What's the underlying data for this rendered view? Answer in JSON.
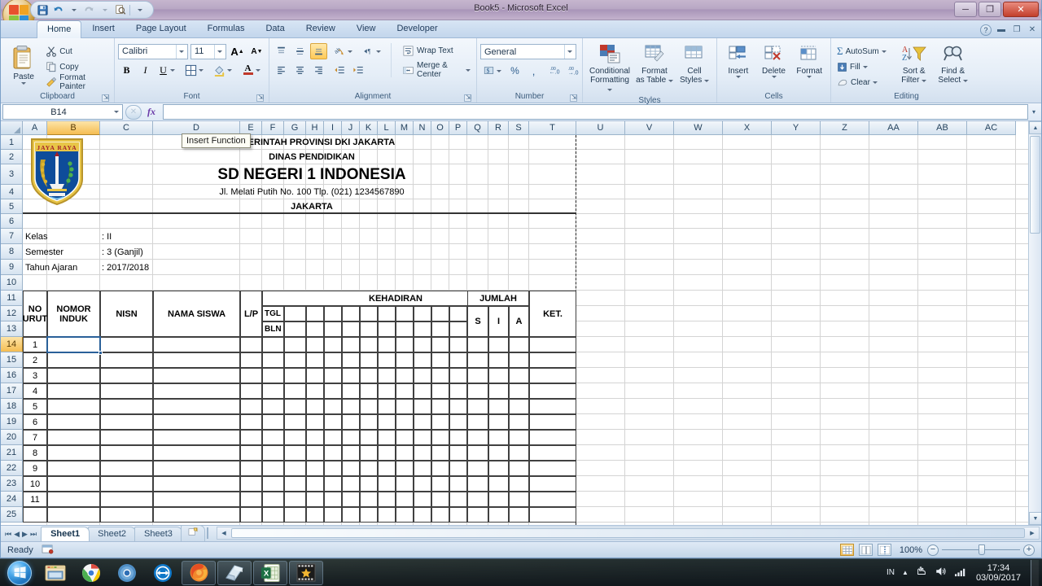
{
  "window": {
    "title": "Book5 - Microsoft Excel",
    "minimize": "─",
    "restore": "❐",
    "close": "✕"
  },
  "quick_access": {
    "save": "save-icon",
    "undo": "undo-icon",
    "redo": "redo-icon",
    "print_preview": "print-preview-icon",
    "customize": "customize-qat-icon"
  },
  "ribbon": {
    "tabs": [
      {
        "label": "Home",
        "active": true
      },
      {
        "label": "Insert",
        "active": false
      },
      {
        "label": "Page Layout",
        "active": false
      },
      {
        "label": "Formulas",
        "active": false
      },
      {
        "label": "Data",
        "active": false
      },
      {
        "label": "Review",
        "active": false
      },
      {
        "label": "View",
        "active": false
      },
      {
        "label": "Developer",
        "active": false
      }
    ],
    "help": "?",
    "minimize_ribbon": "▬",
    "restore_window": "❐",
    "close_window": "✕",
    "groups": {
      "clipboard": {
        "label": "Clipboard",
        "paste": "Paste",
        "cut": "Cut",
        "copy": "Copy",
        "format_painter": "Format Painter"
      },
      "font": {
        "label": "Font",
        "font_name": "Calibri",
        "font_size": "11",
        "grow_font": "A",
        "shrink_font": "A",
        "bold": "B",
        "italic": "I",
        "underline": "U",
        "borders": "borders-icon",
        "fill_color": "fill-color-icon",
        "font_color": "A"
      },
      "alignment": {
        "label": "Alignment",
        "align_top": "align-top-icon",
        "align_middle": "align-middle-icon",
        "align_bottom": "align-bottom-icon",
        "orientation": "orientation-icon",
        "decrease_indent": "decrease-indent-icon",
        "align_left": "align-left-icon",
        "align_center": "align-center-icon",
        "align_right": "align-right-icon",
        "indent_less": "indent-less-icon",
        "indent_more": "indent-more-icon",
        "wrap_text": "Wrap Text",
        "merge_center": "Merge & Center"
      },
      "number": {
        "label": "Number",
        "format": "General",
        "accounting": "accounting-format-icon",
        "percent": "%",
        "comma": ",",
        "increase_decimal": "increase-decimal-icon",
        "decrease_decimal": "decrease-decimal-icon"
      },
      "styles": {
        "label": "Styles",
        "conditional_formatting": "Conditional\nFormatting",
        "conditional_formatting_l1": "Conditional",
        "conditional_formatting_l2": "Formatting",
        "format_as_table_l1": "Format",
        "format_as_table_l2": "as Table",
        "cell_styles_l1": "Cell",
        "cell_styles_l2": "Styles"
      },
      "cells": {
        "label": "Cells",
        "insert": "Insert",
        "delete": "Delete",
        "format": "Format"
      },
      "editing": {
        "label": "Editing",
        "autosum": "AutoSum",
        "fill": "Fill",
        "clear": "Clear",
        "sort_filter_l1": "Sort &",
        "sort_filter_l2": "Filter",
        "find_select_l1": "Find &",
        "find_select_l2": "Select"
      }
    }
  },
  "formula_bar": {
    "name_box": "B14",
    "cancel": "✕",
    "enter": "✓",
    "insert_function": "fx",
    "value": ""
  },
  "tooltip": {
    "text": "Insert Function"
  },
  "grid": {
    "columns": [
      "A",
      "B",
      "C",
      "D",
      "E",
      "F",
      "G",
      "H",
      "I",
      "J",
      "K",
      "L",
      "M",
      "N",
      "O",
      "P",
      "Q",
      "R",
      "S",
      "T",
      "U",
      "V",
      "W",
      "X",
      "Y",
      "Z",
      "AA",
      "AB",
      "AC"
    ],
    "selected_column": "B",
    "selected_row": "14",
    "rows": [
      "1",
      "2",
      "3",
      "4",
      "5",
      "6",
      "7",
      "8",
      "9",
      "10",
      "11",
      "12",
      "13",
      "14",
      "15",
      "16",
      "17",
      "18",
      "19",
      "20",
      "21",
      "22",
      "23",
      "24",
      "25"
    ]
  },
  "sheet": {
    "logo": {
      "motto": "JAYA RAYA",
      "alt": "jakarta-coat-of-arms"
    },
    "header": {
      "line1": "PEMERINTAH PROVINSI DKI JAKARTA",
      "line2": "DINAS PENDIDIKAN",
      "line3": "SD NEGERI 1 INDONESIA",
      "line4": "Jl. Melati Putih No. 100 Tlp. (021) 1234567890",
      "line5": "JAKARTA"
    },
    "info": [
      {
        "label": "Kelas",
        "value": ": II"
      },
      {
        "label": "Semester",
        "value": ": 3 (Ganjil)"
      },
      {
        "label": "Tahun Ajaran",
        "value": ": 2017/2018"
      }
    ],
    "table": {
      "headers": {
        "no_urut_l1": "NO",
        "no_urut_l2": "URUT",
        "nomor_induk_l1": "NOMOR",
        "nomor_induk_l2": "INDUK",
        "nisn": "NISN",
        "nama_siswa": "NAMA SISWA",
        "lp": "L/P",
        "kehadiran": "KEHADIRAN",
        "tgl": "TGL",
        "bln": "BLN",
        "jumlah": "JUMLAH",
        "jumlah_s": "S",
        "jumlah_i": "I",
        "jumlah_a": "A",
        "ket": "KET."
      },
      "row_numbers": [
        "1",
        "2",
        "3",
        "4",
        "5",
        "6",
        "7",
        "8",
        "9",
        "10",
        "11"
      ]
    }
  },
  "sheet_tabs": {
    "first": "⏮",
    "prev": "◀",
    "next": "▶",
    "last": "⏭",
    "tabs": [
      {
        "label": "Sheet1",
        "active": true
      },
      {
        "label": "Sheet2",
        "active": false
      },
      {
        "label": "Sheet3",
        "active": false
      }
    ],
    "insert_worksheet": "insert-worksheet-icon"
  },
  "status_bar": {
    "mode": "Ready",
    "macro_record": "record-macro-icon",
    "view_normal": "normal-view-icon",
    "view_page_layout": "page-layout-view-icon",
    "view_page_break": "page-break-view-icon",
    "zoom": "100%",
    "zoom_out": "−",
    "zoom_in": "+"
  },
  "taskbar": {
    "start": "start-orb-icon",
    "items": [
      {
        "name": "windows-explorer-icon",
        "running": false
      },
      {
        "name": "google-chrome-icon",
        "running": false
      },
      {
        "name": "chromium-icon",
        "running": false
      },
      {
        "name": "teamviewer-icon",
        "running": false
      },
      {
        "name": "mozilla-firefox-icon",
        "running": true
      },
      {
        "name": "notepad-icon",
        "running": true
      },
      {
        "name": "microsoft-excel-icon",
        "running": true
      },
      {
        "name": "video-editor-icon",
        "running": true
      }
    ],
    "tray": {
      "language": "IN",
      "show_hidden": "▲",
      "action_center": "action-center-icon",
      "volume": "volume-icon",
      "network": "network-icon"
    },
    "time": "17:34",
    "date": "03/09/2017"
  }
}
